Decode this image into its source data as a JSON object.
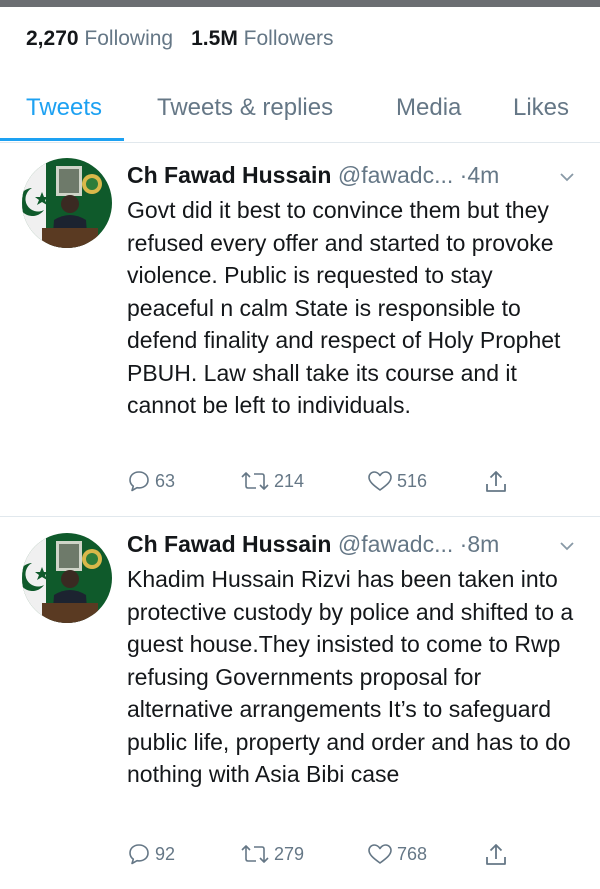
{
  "profile_stats": {
    "following_count": "2,270",
    "following_label": "Following",
    "followers_count": "1.5M",
    "followers_label": "Followers"
  },
  "tabs": [
    {
      "label": "Tweets",
      "active": true
    },
    {
      "label": "Tweets & replies",
      "active": false
    },
    {
      "label": "Media",
      "active": false
    },
    {
      "label": "Likes",
      "active": false
    }
  ],
  "tweets": [
    {
      "name": "Ch Fawad Hussain",
      "handle": "@fawadc...",
      "time": "·4m",
      "text": "Govt did it best to convince them but they refused every offer and started to provoke violence. Public is requested to stay peaceful n calm State is responsible to defend finality and respect of Holy Prophet PBUH. Law shall take its course and it cannot be left to individuals.",
      "replies": "63",
      "retweets": "214",
      "likes": "516"
    },
    {
      "name": "Ch Fawad Hussain",
      "handle": "@fawadc...",
      "time": "·8m",
      "text": "Khadim Hussain Rizvi has been taken into protective custody by police and shifted to a guest house.They insisted to come to Rwp refusing Governments proposal for alternative arrangements It’s to safeguard public life, property and order and has to do nothing with Asia Bibi case",
      "replies": "92",
      "retweets": "279",
      "likes": "768"
    }
  ],
  "colors": {
    "accent": "#1da1f2",
    "muted": "#657786",
    "text": "#14171a",
    "border": "#e1e8ed"
  },
  "icons": [
    "reply-icon",
    "retweet-icon",
    "heart-icon",
    "share-icon",
    "chevron-down-icon"
  ]
}
